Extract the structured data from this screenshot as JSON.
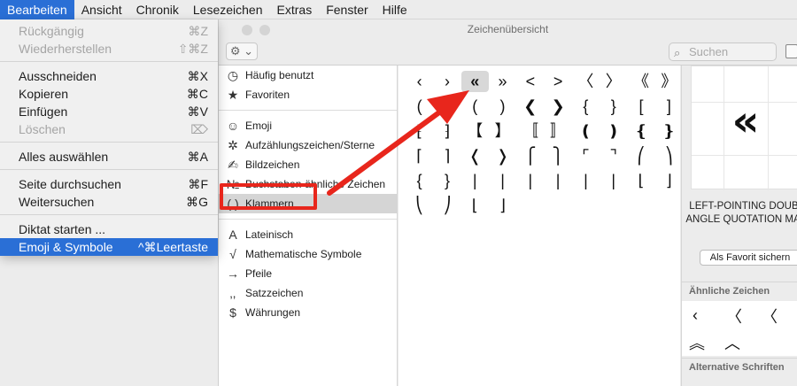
{
  "menubar": {
    "items": [
      "Bearbeiten",
      "Ansicht",
      "Chronik",
      "Lesezeichen",
      "Extras",
      "Fenster",
      "Hilfe"
    ],
    "active_index": 0
  },
  "edit_menu": {
    "items": [
      {
        "label": "Rückgängig",
        "shortcut": "⌘Z",
        "enabled": false
      },
      {
        "label": "Wiederherstellen",
        "shortcut": "⇧⌘Z",
        "enabled": false
      },
      {
        "label": "Ausschneiden",
        "shortcut": "⌘X",
        "enabled": true
      },
      {
        "label": "Kopieren",
        "shortcut": "⌘C",
        "enabled": true
      },
      {
        "label": "Einfügen",
        "shortcut": "⌘V",
        "enabled": true
      },
      {
        "label": "Löschen",
        "shortcut": "⌦",
        "enabled": false
      },
      {
        "label": "Alles auswählen",
        "shortcut": "⌘A",
        "enabled": true
      },
      {
        "label": "Seite durchsuchen",
        "shortcut": "⌘F",
        "enabled": true
      },
      {
        "label": "Weitersuchen",
        "shortcut": "⌘G",
        "enabled": true
      },
      {
        "label": "Diktat starten ...",
        "shortcut": "",
        "enabled": true
      },
      {
        "label": "Emoji & Symbole",
        "shortcut": "^⌘Leertaste",
        "enabled": true,
        "highlighted": true
      }
    ]
  },
  "viewer": {
    "title": "Zeichenübersicht",
    "search_placeholder": "Suchen",
    "gear_label": "⚙︎ ⌄",
    "categories": [
      {
        "icon": "◷",
        "label": "Häufig benutzt"
      },
      {
        "icon": "★",
        "label": "Favoriten"
      },
      {
        "icon": "☺",
        "label": "Emoji"
      },
      {
        "icon": "✲",
        "label": "Aufzählungszeichen/Sterne"
      },
      {
        "icon": "✍",
        "label": "Bildzeichen"
      },
      {
        "icon": "№",
        "label": "Buchstaben-ähnliche Zeichen"
      },
      {
        "icon": "( )",
        "label": "Klammern",
        "selected": true
      },
      {
        "icon": "A",
        "label": "Lateinisch"
      },
      {
        "icon": "√",
        "label": "Mathematische Symbole"
      },
      {
        "icon": "→",
        "label": "Pfeile"
      },
      {
        "icon": "‚,",
        "label": "Satzzeichen"
      },
      {
        "icon": "$",
        "label": "Währungen"
      }
    ],
    "char_rows": [
      [
        "‹",
        "›",
        "«",
        "»",
        "<",
        ">",
        "〈",
        "〉",
        "《",
        "》"
      ],
      [
        "(",
        ")",
        "(",
        ")",
        "❮",
        "❯",
        "{",
        "}",
        "[",
        "]"
      ],
      [
        "⁅",
        "⁆",
        "【",
        "】",
        "〚",
        "〛",
        "❪",
        "❫",
        "❴",
        "❵"
      ],
      [
        "⌈",
        "⌉",
        "❬",
        "❭",
        "⎧",
        "⎫",
        "⌜",
        "⌝",
        "⎛",
        "⎞"
      ],
      [
        "{",
        "}",
        "|",
        "|",
        "|",
        "|",
        "|",
        "|",
        "⌊",
        "⌋"
      ],
      [
        "⎝",
        "⎠",
        "⌊",
        "⌋"
      ]
    ],
    "selected_char": "«",
    "info": {
      "glyph": "«",
      "name": "LEFT-POINTING DOUBLE ANGLE QUOTATION MARK",
      "fav_button": "Als Favorit sichern",
      "similar_title": "Ähnliche Zeichen",
      "similar": [
        "‹",
        "〈",
        "〈",
        "︽",
        "︿"
      ],
      "alt_fonts_title": "Alternative Schriften"
    }
  },
  "annotation_color": "#e8261c",
  "accent": "#2a6fd6"
}
